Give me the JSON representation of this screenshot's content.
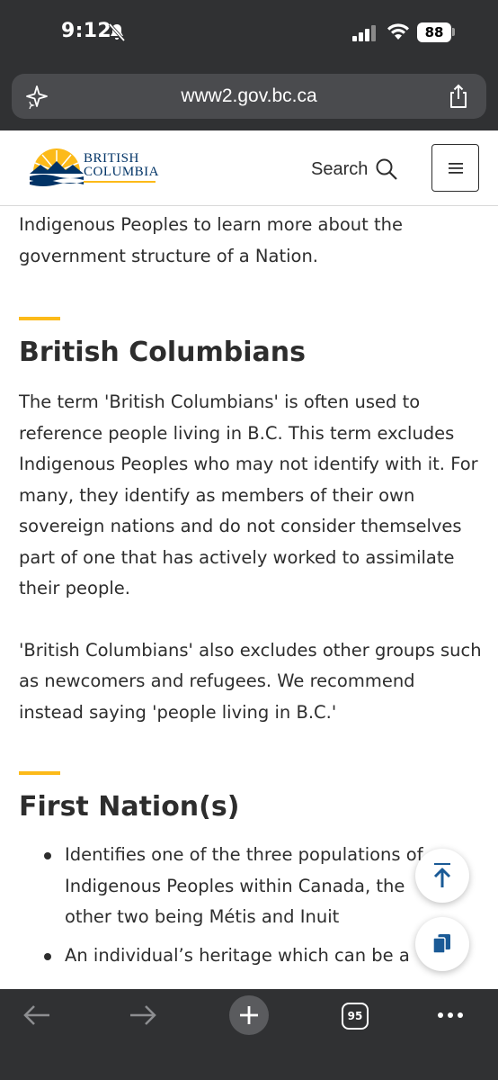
{
  "status_bar": {
    "time": "9:12",
    "battery": "88"
  },
  "browser": {
    "url": "www2.gov.bc.ca",
    "tab_count": "95"
  },
  "header": {
    "logo_line1": "BRITISH",
    "logo_line2": "COLUMBIA",
    "search_label": "Search"
  },
  "content": {
    "intro_text": "Indigenous Peoples to learn more about the government structure of a Nation.",
    "section1": {
      "heading": "British Columbians",
      "paragraph1": "The term 'British Columbians' is often used to reference people living in B.C. This term excludes Indigenous Peoples who may not identify with it. For many, they identify as members of their own sovereign nations and do not consider themselves part of one that has actively worked to assimilate their people.",
      "paragraph2": "'British Columbians' also excludes other groups such as newcomers and refugees. We recommend instead saying 'people living in B.C.'"
    },
    "section2": {
      "heading": "First Nation(s)",
      "bullets": [
        "Identifies one of the three populations of Indigenous Peoples within Canada, the other two being Métis and Inuit",
        "An individual’s heritage which can be a"
      ]
    }
  },
  "colors": {
    "accent": "#fcba19",
    "brand_blue": "#013366",
    "text": "#2d2d2d",
    "chrome": "#303133"
  },
  "icons": [
    "bell-off-icon",
    "signal-icon",
    "wifi-icon",
    "sparkle-icon",
    "share-icon",
    "search-icon",
    "hamburger-icon",
    "arrow-up-icon",
    "copy-icon",
    "back-arrow-icon",
    "forward-arrow-icon",
    "plus-icon",
    "more-icon"
  ]
}
